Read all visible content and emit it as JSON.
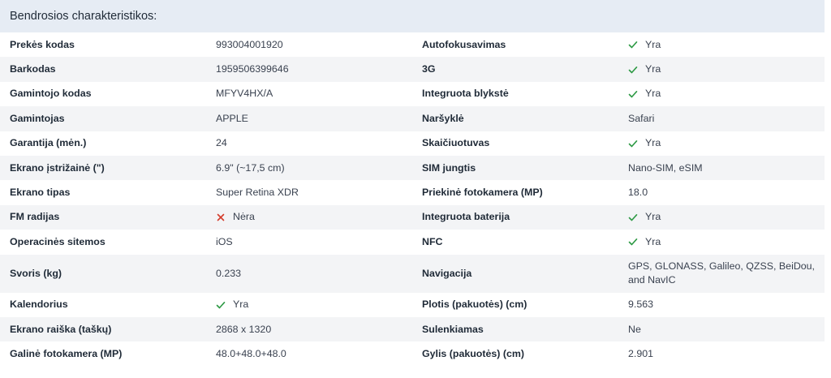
{
  "header": {
    "title": "Bendrosios charakteristikos:"
  },
  "colors": {
    "check": "#2e9a45",
    "cross": "#d43c2b",
    "header_bg": "#e6ecf4",
    "stripe_bg": "#f3f4f6"
  },
  "rows": [
    {
      "left": {
        "label": "Prekės kodas",
        "value": "993004001920",
        "icon": null
      },
      "right": {
        "label": "Autofokusavimas",
        "value": "Yra",
        "icon": "check-icon"
      }
    },
    {
      "left": {
        "label": "Barkodas",
        "value": "1959506399646",
        "icon": null
      },
      "right": {
        "label": "3G",
        "value": "Yra",
        "icon": "check-icon"
      }
    },
    {
      "left": {
        "label": "Gamintojo kodas",
        "value": "MFYV4HX/A",
        "icon": null
      },
      "right": {
        "label": "Integruota blykstė",
        "value": "Yra",
        "icon": "check-icon"
      }
    },
    {
      "left": {
        "label": "Gamintojas",
        "value": "APPLE",
        "icon": null
      },
      "right": {
        "label": "Naršyklė",
        "value": "Safari",
        "icon": null
      }
    },
    {
      "left": {
        "label": "Garantija (mėn.)",
        "value": "24",
        "icon": null
      },
      "right": {
        "label": "Skaičiuotuvas",
        "value": "Yra",
        "icon": "check-icon"
      }
    },
    {
      "left": {
        "label": "Ekrano įstrižainė (\")",
        "value": "6.9\" (~17,5 cm)",
        "icon": null
      },
      "right": {
        "label": "SIM jungtis",
        "value": "Nano-SIM, eSIM",
        "icon": null
      }
    },
    {
      "left": {
        "label": "Ekrano tipas",
        "value": "Super Retina XDR",
        "icon": null
      },
      "right": {
        "label": "Priekinė fotokamera (MP)",
        "value": "18.0",
        "icon": null
      }
    },
    {
      "left": {
        "label": "FM radijas",
        "value": "Nėra",
        "icon": "cross-icon"
      },
      "right": {
        "label": "Integruota baterija",
        "value": "Yra",
        "icon": "check-icon"
      }
    },
    {
      "left": {
        "label": "Operacinės sitemos",
        "value": "iOS",
        "icon": null
      },
      "right": {
        "label": "NFC",
        "value": "Yra",
        "icon": "check-icon"
      }
    },
    {
      "left": {
        "label": "Svoris (kg)",
        "value": "0.233",
        "icon": null
      },
      "right": {
        "label": "Navigacija",
        "value": "GPS, GLONASS, Galileo, QZSS, BeiDou, and NavIC",
        "icon": null
      }
    },
    {
      "left": {
        "label": "Kalendorius",
        "value": "Yra",
        "icon": "check-icon"
      },
      "right": {
        "label": "Plotis (pakuotės) (cm)",
        "value": "9.563",
        "icon": null
      }
    },
    {
      "left": {
        "label": "Ekrano raiška (taškų)",
        "value": "2868 x 1320",
        "icon": null
      },
      "right": {
        "label": "Sulenkiamas",
        "value": "Ne",
        "icon": null
      }
    },
    {
      "left": {
        "label": "Galinė fotokamera (MP)",
        "value": "48.0+48.0+48.0",
        "icon": null
      },
      "right": {
        "label": "Gylis (pakuotės) (cm)",
        "value": "2.901",
        "icon": null
      }
    }
  ]
}
